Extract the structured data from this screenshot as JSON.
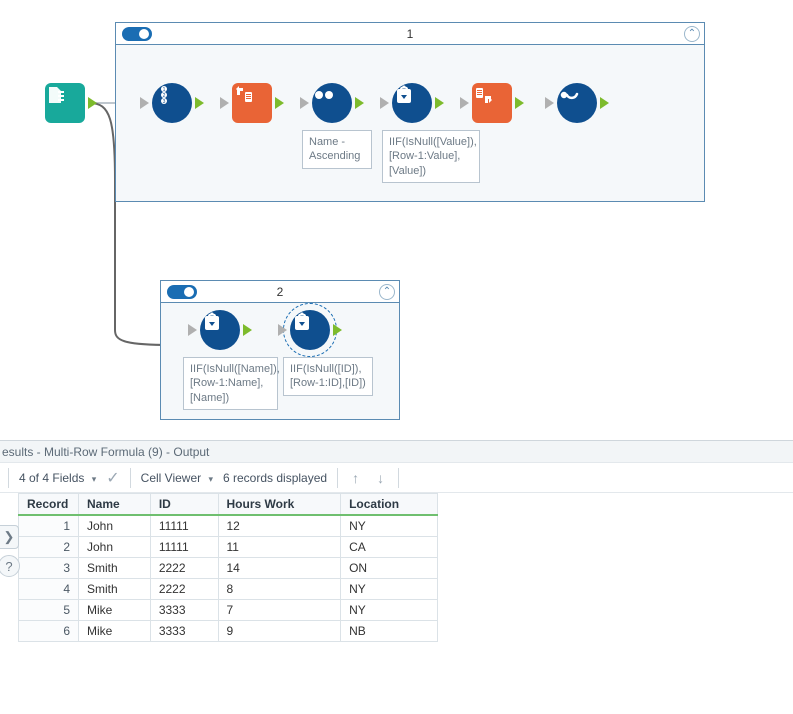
{
  "containers": {
    "c1": {
      "title": "1"
    },
    "c2": {
      "title": "2"
    }
  },
  "annotations": {
    "sort": "Name - Ascending",
    "mrf1": "IIF(IsNull([Value]),[Row-1:Value],[Value])",
    "mrf2a": "IIF(IsNull([Name]),[Row-1:Name],[Name])",
    "mrf2b": "IIF(IsNull([ID]),[Row-1:ID],[ID])"
  },
  "results": {
    "title": "esults - Multi-Row Formula (9) - Output",
    "fields_label": "4 of 4 Fields",
    "cell_viewer_label": "Cell Viewer",
    "records_label": "6 records displayed"
  },
  "table": {
    "columns": [
      "Record",
      "Name",
      "ID",
      "Hours Work",
      "Location"
    ],
    "rows": [
      {
        "Record": "1",
        "Name": "John",
        "ID": "11111",
        "Hours Work": "12",
        "Location": "NY"
      },
      {
        "Record": "2",
        "Name": "John",
        "ID": "11111",
        "Hours Work": "11",
        "Location": "CA"
      },
      {
        "Record": "3",
        "Name": "Smith",
        "ID": "2222",
        "Hours Work": "14",
        "Location": "ON"
      },
      {
        "Record": "4",
        "Name": "Smith",
        "ID": "2222",
        "Hours Work": "8",
        "Location": "NY"
      },
      {
        "Record": "5",
        "Name": "Mike",
        "ID": "3333",
        "Hours Work": "7",
        "Location": "NY"
      },
      {
        "Record": "6",
        "Name": "Mike",
        "ID": "3333",
        "Hours Work": "9",
        "Location": "NB"
      }
    ]
  },
  "icons": {
    "chevron_up": "⌃",
    "check": "✓",
    "up_arrow": "↑",
    "down_arrow": "↓",
    "tag": "❯",
    "help": "?"
  }
}
